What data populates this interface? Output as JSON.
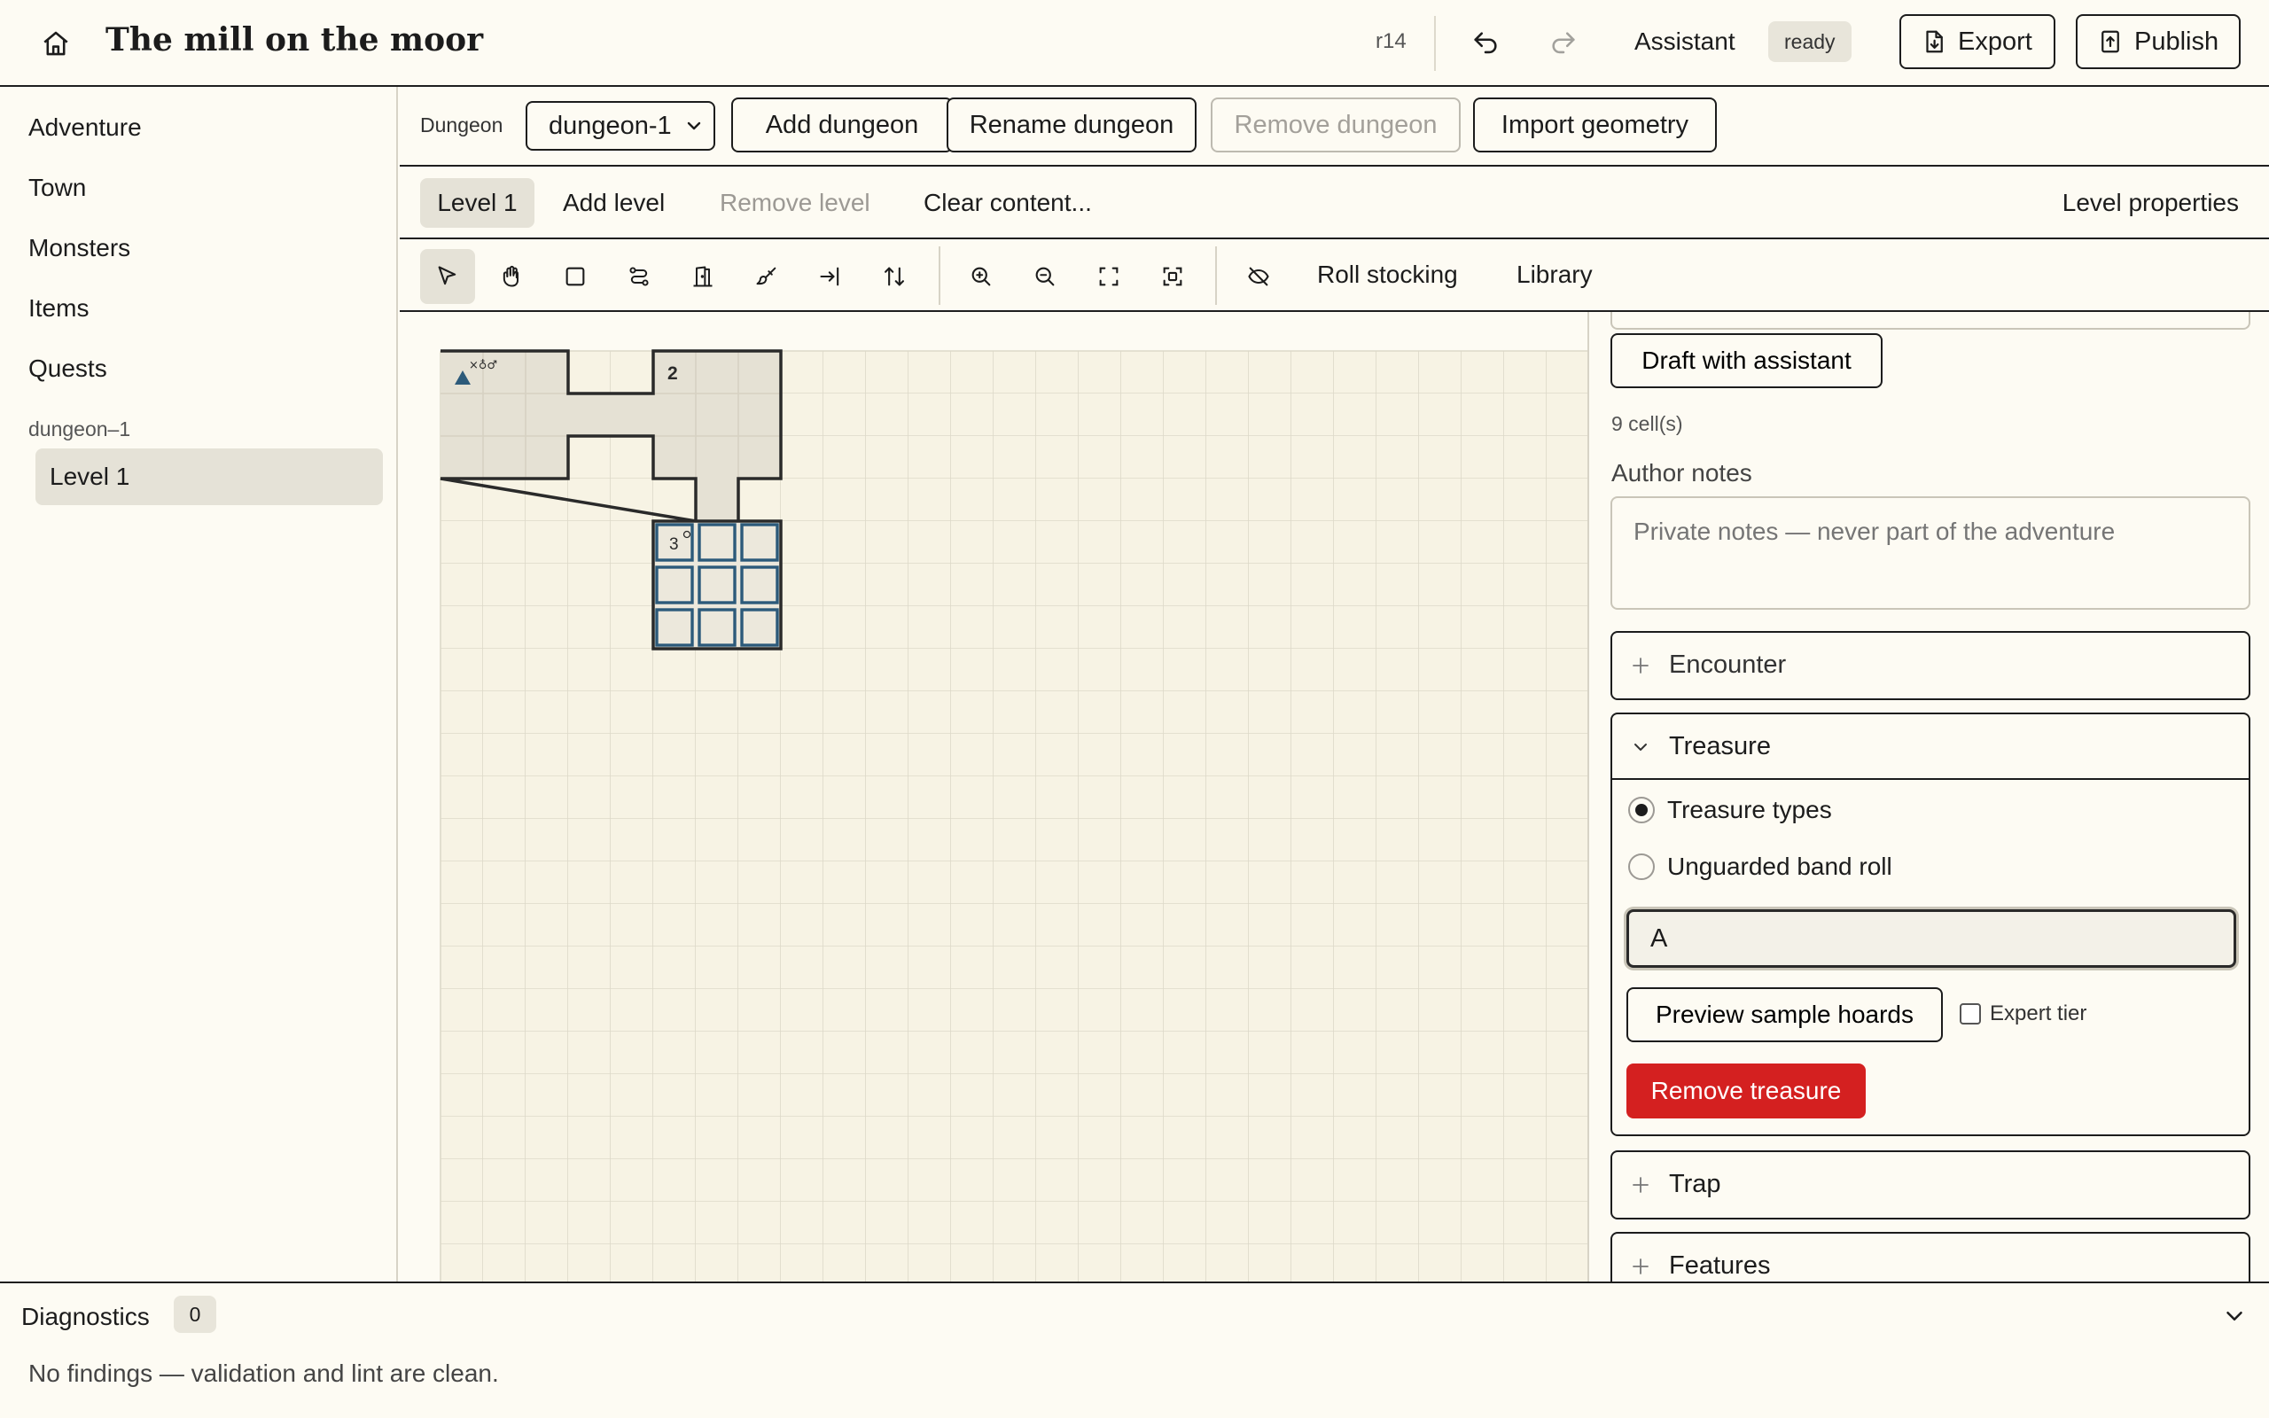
{
  "app": {
    "title": "The mill on the moor",
    "revision": "r14",
    "assistant_label": "Assistant",
    "assistant_status": "ready",
    "export_label": "Export",
    "publish_label": "Publish"
  },
  "sidebar": {
    "items": [
      {
        "label": "Adventure"
      },
      {
        "label": "Town"
      },
      {
        "label": "Monsters"
      },
      {
        "label": "Items"
      },
      {
        "label": "Quests"
      }
    ],
    "dungeon_group": "dungeon–1",
    "level_item": "Level 1"
  },
  "dungeon_bar": {
    "label": "Dungeon",
    "selected": "dungeon-1",
    "add": "Add dungeon",
    "rename": "Rename dungeon",
    "remove": "Remove dungeon",
    "import": "Import geometry"
  },
  "level_bar": {
    "active_tab": "Level 1",
    "add": "Add level",
    "remove": "Remove level",
    "clear": "Clear content...",
    "properties": "Level properties"
  },
  "tools": {
    "items": [
      "select-icon",
      "pan-icon",
      "room-icon",
      "corridor-icon",
      "door-icon",
      "paint-icon",
      "entrance-icon",
      "stairs-icon",
      "zoom-in-icon",
      "zoom-out-icon",
      "fit-icon",
      "focus-icon",
      "hide-icon"
    ],
    "roll_stocking": "Roll stocking",
    "library": "Library"
  },
  "map": {
    "rooms": [
      {
        "label": "",
        "marker": "entrance"
      },
      {
        "label": "2"
      },
      {
        "label": "3"
      }
    ]
  },
  "panel": {
    "draft_button": "Draft with assistant",
    "cell_count": "9 cell(s)",
    "author_notes_label": "Author notes",
    "author_notes_placeholder": "Private notes — never part of the adventure",
    "encounter": "Encounter",
    "treasure": {
      "title": "Treasure",
      "option_types": "Treasure types",
      "option_band": "Unguarded band roll",
      "selected_option": "Treasure types",
      "value": "A",
      "preview_button": "Preview sample hoards",
      "expert_tier": "Expert tier",
      "expert_checked": false,
      "remove_button": "Remove treasure"
    },
    "trap": "Trap",
    "features": "Features"
  },
  "diagnostics": {
    "title": "Diagnostics",
    "count": "0",
    "message": "No findings — validation and lint are clean."
  },
  "colors": {
    "background": "#fdfbf3",
    "room_fill": "#e5e1d4",
    "selected_room": "#2c5a7a",
    "danger": "#d42020"
  }
}
